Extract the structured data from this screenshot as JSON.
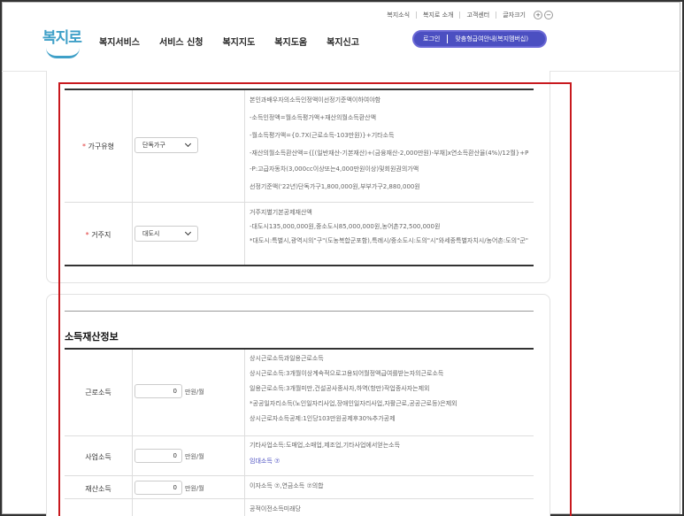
{
  "util_links": [
    "복지소식",
    "복지로 소개",
    "고객센터",
    "글자크기"
  ],
  "util_plus": "+",
  "util_minus": "−",
  "logo_text": "복지로",
  "nav": [
    "복지서비스",
    "서비스 신청",
    "복지지도",
    "복지도움",
    "복지신고"
  ],
  "login": {
    "login_label": "로그인",
    "bot_label": "맞춤형급여안내(복지멤버십)"
  },
  "household": {
    "label": "가구유형",
    "required": "*",
    "select_value": "단독가구",
    "desc": [
      "본인과배우자의소득인정액이선정기준액이하여야함",
      "-소득인정액=월소득평가액+재산의월소득환산액",
      "-월소득평가액={0.7X(근로소득-103만원)}+기타소득",
      "-재산의월소득환산액={[(일반재산-기본재산)+(금융재산-2,000만원)-부채]x연소득환산율(4%)/12월}+P",
      "-P:고급자동차(3,000cc이상또는4,000만원이상)및회원권의가액",
      "선정기준액('22년)단독가구1,800,000원,부부가구2,880,000원"
    ]
  },
  "residence": {
    "label": "거주지",
    "required": "*",
    "select_value": "대도시",
    "desc": [
      "거주지별기본공제재산액",
      "-대도시135,000,000원,중소도시85,000,000원,농어촌72,500,000원",
      "*대도시:특별시,광역시의\"구\"(도농복합군포함),특례시/중소도시:도의\"시\"와세종특별자치시/농어촌:도의\"군\""
    ]
  },
  "section_title": "소득재산정보",
  "income": {
    "earned": {
      "label": "근로소득",
      "value": "0",
      "unit": "만원/월",
      "desc": [
        "상시근로소득과일용근로소득",
        "상시근로소득:3개월이상계속적으로고용되어월정액급여를받는자의근로소득",
        "일용근로소득:3개월미만,건설공사종사자,하역(항만)작업종사자는제외",
        "*공공일자리소득(노인일자리사업,장애인일자리사업,자활근로,공공근로등)은제외",
        "상시근로자소득공제:1인당103만원공제후30%추가공제"
      ]
    },
    "business": {
      "label": "사업소득",
      "value": "0",
      "unit": "만원/월",
      "desc": "기타사업소득:도매업,소매업,제조업,기타사업에서얻는소득",
      "link": "임대소득 ⑦"
    },
    "property": {
      "label": "재산소득",
      "value": "0",
      "unit": "만원/월",
      "desc": "이자소득 ⑦,연금소득 ⑦의합"
    },
    "public_desc": "공적이전소득미래당"
  },
  "colors": {
    "accent": "#4b4fc1",
    "highlight": "#c8191e",
    "logo": "#3fa0c8",
    "required": "#e23b3b"
  }
}
